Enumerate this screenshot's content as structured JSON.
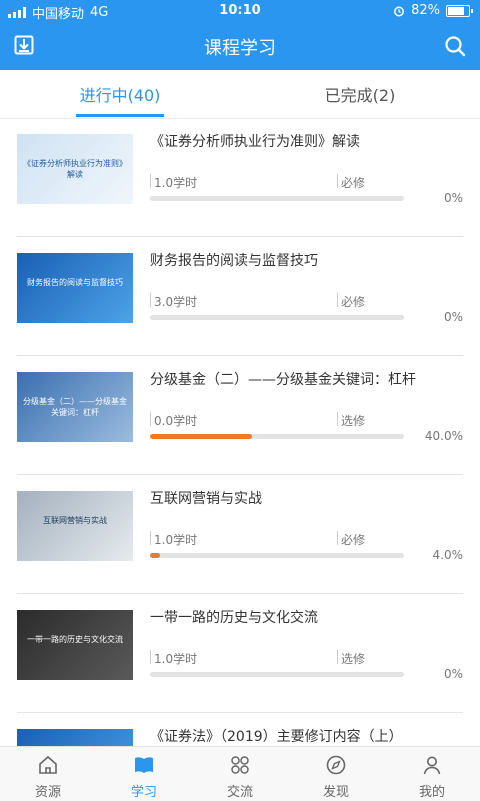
{
  "status_bar": {
    "carrier": "中国移动",
    "network": "4G",
    "time": "10:10",
    "battery": "82%"
  },
  "header": {
    "title": "课程学习",
    "download_icon": "download-icon",
    "search_icon": "search-icon"
  },
  "tabs": [
    {
      "label": "进行中(40)",
      "active": true
    },
    {
      "label": "已完成(2)",
      "active": false
    }
  ],
  "courses": [
    {
      "title": "《证券分析师执业行为准则》解读",
      "thumb_text": "《证券分析师执业行为准则》解读",
      "hours": "1.0学时",
      "type": "必修",
      "progress": 0,
      "progress_label": "0%"
    },
    {
      "title": "财务报告的阅读与监督技巧",
      "thumb_text": "财务报告的阅读与监督技巧",
      "hours": "3.0学时",
      "type": "必修",
      "progress": 0,
      "progress_label": "0%"
    },
    {
      "title": "分级基金（二）——分级基金关键词：杠杆",
      "thumb_text": "分级基金（二）——分级基金关键词：杠杆",
      "hours": "0.0学时",
      "type": "选修",
      "progress": 0.4,
      "progress_label": "40.0%"
    },
    {
      "title": "互联网营销与实战",
      "thumb_text": "互联网营销与实战",
      "hours": "1.0学时",
      "type": "必修",
      "progress": 0.04,
      "progress_label": "4.0%"
    },
    {
      "title": "一带一路的历史与文化交流",
      "thumb_text": "一带一路的历史与文化交流",
      "hours": "1.0学时",
      "type": "选修",
      "progress": 0,
      "progress_label": "0%"
    },
    {
      "title": "《证券法》（2019）主要修订内容（上）",
      "thumb_text": "",
      "hours": "",
      "type": "",
      "progress": 0,
      "progress_label": ""
    }
  ],
  "bottom_nav": [
    {
      "label": "资源",
      "icon": "home-icon",
      "active": false
    },
    {
      "label": "学习",
      "icon": "book-icon",
      "active": true
    },
    {
      "label": "交流",
      "icon": "grid-icon",
      "active": false
    },
    {
      "label": "发现",
      "icon": "compass-icon",
      "active": false
    },
    {
      "label": "我的",
      "icon": "user-icon",
      "active": false
    }
  ],
  "colors": {
    "accent": "#2b96f0",
    "progress": "#f07826"
  }
}
